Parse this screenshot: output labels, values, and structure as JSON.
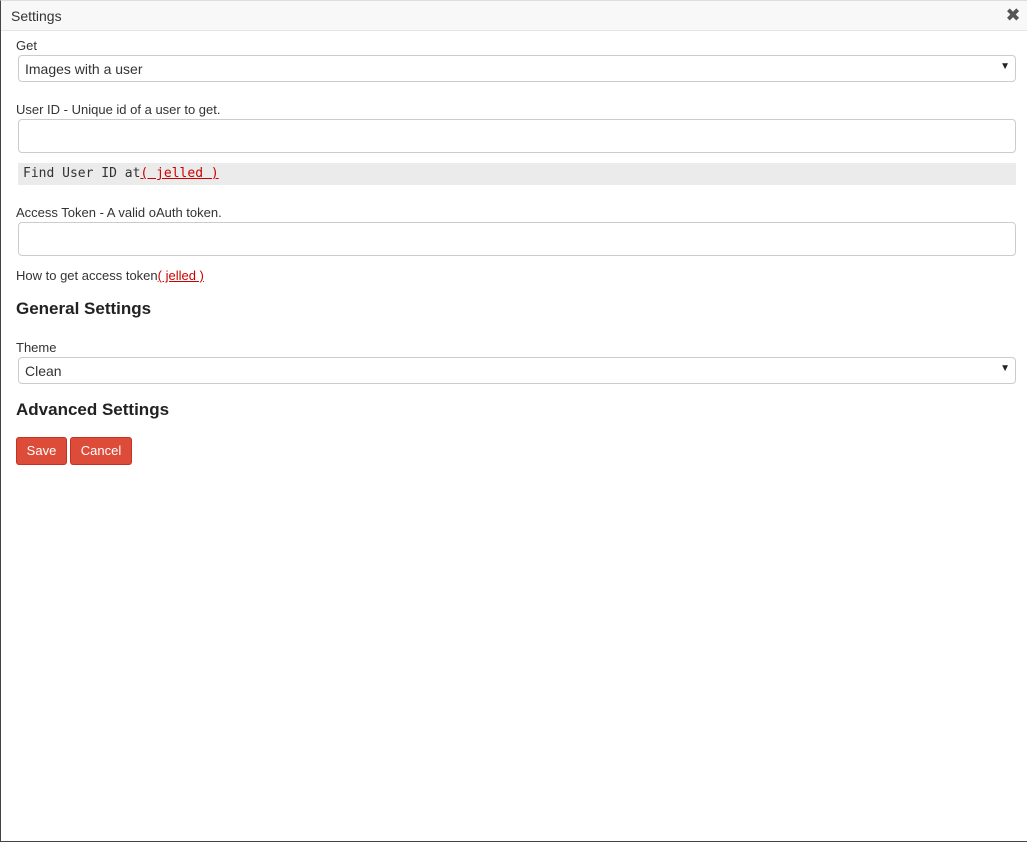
{
  "dialog": {
    "title": "Settings",
    "close_icon": "close-icon",
    "close_symbol": "✖"
  },
  "get": {
    "label": "Get",
    "value": "Images with a user"
  },
  "user_id": {
    "label": "User ID - Unique id of a user to get.",
    "value": "",
    "hint_text": "Find User ID at",
    "hint_link": "( jelled )"
  },
  "access_token": {
    "label": "Access Token - A valid oAuth token.",
    "value": "",
    "hint_text": "How to get access token",
    "hint_link": "( jelled )"
  },
  "general_settings": {
    "heading": "General Settings",
    "theme_label": "Theme",
    "theme_value": "Clean"
  },
  "advanced_settings": {
    "heading": "Advanced Settings"
  },
  "actions": {
    "save_label": "Save",
    "cancel_label": "Cancel"
  },
  "colors": {
    "button_red": "#dd4b39",
    "link_red": "#cc0000"
  }
}
